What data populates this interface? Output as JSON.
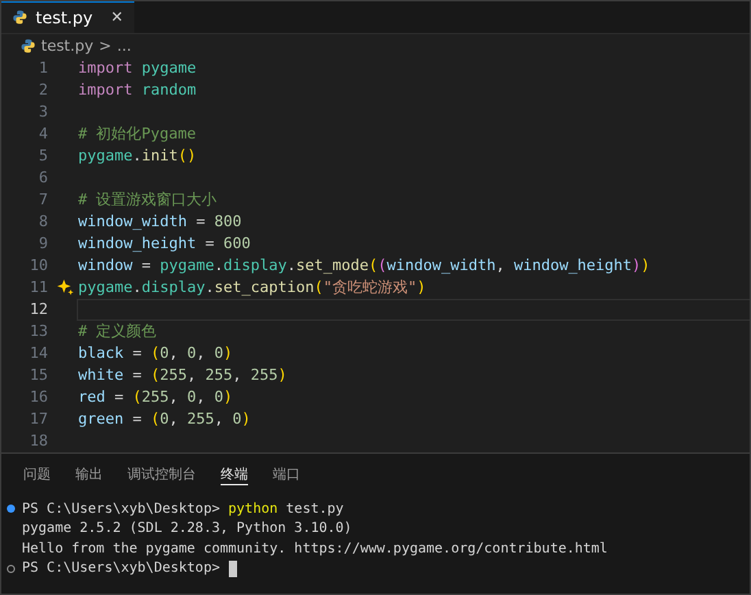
{
  "tabs": [
    {
      "label": "test.py",
      "selected": true,
      "close": "✕"
    }
  ],
  "breadcrumb": {
    "file": "test.py",
    "separator": ">",
    "rest": "..."
  },
  "editor": {
    "lines": [
      {
        "number": "1",
        "current": false,
        "tokens": [
          {
            "kind": "keyword",
            "text": "import "
          },
          {
            "kind": "module",
            "text": "pygame"
          }
        ]
      },
      {
        "number": "2",
        "current": false,
        "tokens": [
          {
            "kind": "keyword",
            "text": "import "
          },
          {
            "kind": "module",
            "text": "random"
          }
        ]
      },
      {
        "number": "3",
        "current": false
      },
      {
        "number": "4",
        "current": false,
        "tokens": [
          {
            "kind": "comment",
            "text": "# 初始化Pygame"
          }
        ]
      },
      {
        "number": "5",
        "current": false,
        "tokens": [
          {
            "kind": "module",
            "text": "pygame"
          },
          {
            "kind": "plain",
            "text": "."
          },
          {
            "kind": "function",
            "text": "init"
          },
          {
            "kind": "bracket1",
            "text": "()"
          }
        ]
      },
      {
        "number": "6",
        "current": false
      },
      {
        "number": "7",
        "current": false,
        "tokens": [
          {
            "kind": "comment",
            "text": "# 设置游戏窗口大小"
          }
        ]
      },
      {
        "number": "8",
        "current": false,
        "tokens": [
          {
            "kind": "variable",
            "text": "window_width"
          },
          {
            "kind": "plain",
            "text": " = "
          },
          {
            "kind": "number",
            "text": "800"
          }
        ]
      },
      {
        "number": "9",
        "current": false,
        "tokens": [
          {
            "kind": "variable",
            "text": "window_height"
          },
          {
            "kind": "plain",
            "text": " = "
          },
          {
            "kind": "number",
            "text": "600"
          }
        ]
      },
      {
        "number": "10",
        "current": false,
        "tokens": [
          {
            "kind": "variable",
            "text": "window"
          },
          {
            "kind": "plain",
            "text": " = "
          },
          {
            "kind": "module",
            "text": "pygame"
          },
          {
            "kind": "plain",
            "text": "."
          },
          {
            "kind": "module",
            "text": "display"
          },
          {
            "kind": "plain",
            "text": "."
          },
          {
            "kind": "function",
            "text": "set_mode"
          },
          {
            "kind": "bracket1",
            "text": "("
          },
          {
            "kind": "bracket2",
            "text": "("
          },
          {
            "kind": "variable",
            "text": "window_width"
          },
          {
            "kind": "plain",
            "text": ", "
          },
          {
            "kind": "variable",
            "text": "window_height"
          },
          {
            "kind": "bracket2",
            "text": ")"
          },
          {
            "kind": "bracket1",
            "text": ")"
          }
        ]
      },
      {
        "number": "11",
        "current": false,
        "sparkle": true,
        "tokens": [
          {
            "kind": "module",
            "text": "pygame"
          },
          {
            "kind": "plain",
            "text": "."
          },
          {
            "kind": "module",
            "text": "display"
          },
          {
            "kind": "plain",
            "text": "."
          },
          {
            "kind": "function",
            "text": "set_caption"
          },
          {
            "kind": "bracket1",
            "text": "("
          },
          {
            "kind": "string",
            "text": "\"贪吃蛇游戏\""
          },
          {
            "kind": "bracket1",
            "text": ")"
          }
        ]
      },
      {
        "number": "12",
        "current": true
      },
      {
        "number": "13",
        "current": false,
        "tokens": [
          {
            "kind": "comment",
            "text": "# 定义颜色"
          }
        ]
      },
      {
        "number": "14",
        "current": false,
        "tokens": [
          {
            "kind": "variable",
            "text": "black"
          },
          {
            "kind": "plain",
            "text": " = "
          },
          {
            "kind": "bracket1",
            "text": "("
          },
          {
            "kind": "number",
            "text": "0"
          },
          {
            "kind": "plain",
            "text": ", "
          },
          {
            "kind": "number",
            "text": "0"
          },
          {
            "kind": "plain",
            "text": ", "
          },
          {
            "kind": "number",
            "text": "0"
          },
          {
            "kind": "bracket1",
            "text": ")"
          }
        ]
      },
      {
        "number": "15",
        "current": false,
        "tokens": [
          {
            "kind": "variable",
            "text": "white"
          },
          {
            "kind": "plain",
            "text": " = "
          },
          {
            "kind": "bracket1",
            "text": "("
          },
          {
            "kind": "number",
            "text": "255"
          },
          {
            "kind": "plain",
            "text": ", "
          },
          {
            "kind": "number",
            "text": "255"
          },
          {
            "kind": "plain",
            "text": ", "
          },
          {
            "kind": "number",
            "text": "255"
          },
          {
            "kind": "bracket1",
            "text": ")"
          }
        ]
      },
      {
        "number": "16",
        "current": false,
        "tokens": [
          {
            "kind": "variable",
            "text": "red"
          },
          {
            "kind": "plain",
            "text": " = "
          },
          {
            "kind": "bracket1",
            "text": "("
          },
          {
            "kind": "number",
            "text": "255"
          },
          {
            "kind": "plain",
            "text": ", "
          },
          {
            "kind": "number",
            "text": "0"
          },
          {
            "kind": "plain",
            "text": ", "
          },
          {
            "kind": "number",
            "text": "0"
          },
          {
            "kind": "bracket1",
            "text": ")"
          }
        ]
      },
      {
        "number": "17",
        "current": false,
        "tokens": [
          {
            "kind": "variable",
            "text": "green"
          },
          {
            "kind": "plain",
            "text": " = "
          },
          {
            "kind": "bracket1",
            "text": "("
          },
          {
            "kind": "number",
            "text": "0"
          },
          {
            "kind": "plain",
            "text": ", "
          },
          {
            "kind": "number",
            "text": "255"
          },
          {
            "kind": "plain",
            "text": ", "
          },
          {
            "kind": "number",
            "text": "0"
          },
          {
            "kind": "bracket1",
            "text": ")"
          }
        ]
      },
      {
        "number": "18",
        "current": false
      }
    ]
  },
  "panel": {
    "tabs": [
      {
        "label": "问题",
        "selected": false
      },
      {
        "label": "输出",
        "selected": false
      },
      {
        "label": "调试控制台",
        "selected": false
      },
      {
        "label": "终端",
        "selected": true
      },
      {
        "label": "端口",
        "selected": false
      }
    ],
    "terminal": [
      {
        "succeeded": true,
        "parts": [
          {
            "kind": "plain",
            "text": "PS C:\\Users\\xyb\\Desktop> "
          },
          {
            "kind": "command",
            "text": "python"
          },
          {
            "kind": "plain",
            "text": " test.py"
          }
        ]
      },
      {
        "parts": [
          {
            "kind": "plain",
            "text": "pygame 2.5.2 (SDL 2.28.3, Python 3.10.0)"
          }
        ]
      },
      {
        "parts": [
          {
            "kind": "plain",
            "text": "Hello from the pygame community. https://www.pygame.org/contribute.html"
          }
        ]
      },
      {
        "succeeded": false,
        "cursor": true,
        "parts": [
          {
            "kind": "plain",
            "text": "PS C:\\Users\\xyb\\Desktop> "
          }
        ]
      }
    ]
  }
}
